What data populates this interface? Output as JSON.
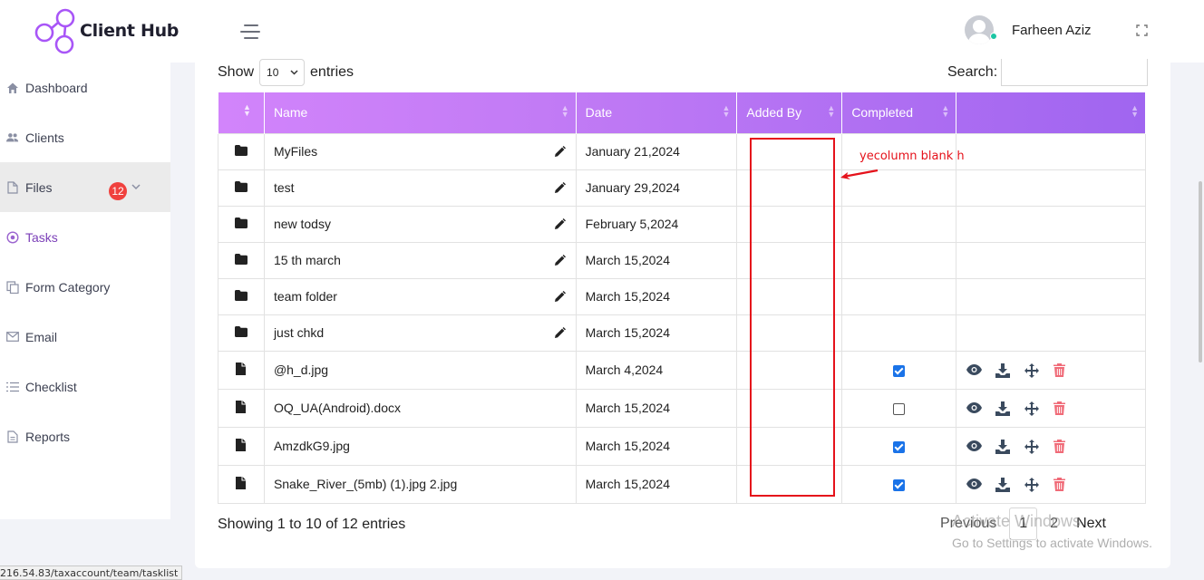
{
  "app": {
    "name": "Client Hub"
  },
  "header": {
    "user_name": "Farheen Aziz"
  },
  "sidebar": {
    "items": [
      {
        "label": "Dashboard",
        "icon": "home-icon"
      },
      {
        "label": "Clients",
        "icon": "users-icon"
      },
      {
        "label": "Files",
        "icon": "file-icon",
        "badge": "12",
        "active": true
      },
      {
        "label": "Tasks",
        "icon": "target-icon"
      },
      {
        "label": "Form Category",
        "icon": "copy-icon"
      },
      {
        "label": "Email",
        "icon": "envelope-icon"
      },
      {
        "label": "Checklist",
        "icon": "list-icon"
      },
      {
        "label": "Reports",
        "icon": "document-icon"
      }
    ]
  },
  "table_controls": {
    "show_label": "Show",
    "entries_label": "entries",
    "page_size": "10",
    "search_label": "Search:"
  },
  "table": {
    "columns": [
      "",
      "Name",
      "Date",
      "Added By",
      "Completed",
      ""
    ],
    "rows": [
      {
        "type": "folder",
        "name": "MyFiles",
        "date": "January 21,2024",
        "added_by": ""
      },
      {
        "type": "folder",
        "name": "test",
        "date": "January 29,2024",
        "added_by": ""
      },
      {
        "type": "folder",
        "name": "new todsy",
        "date": "February 5,2024",
        "added_by": ""
      },
      {
        "type": "folder",
        "name": "15 th march",
        "date": "March 15,2024",
        "added_by": ""
      },
      {
        "type": "folder",
        "name": "team folder",
        "date": "March 15,2024",
        "added_by": ""
      },
      {
        "type": "folder",
        "name": "just chkd",
        "date": "March 15,2024",
        "added_by": ""
      },
      {
        "type": "file",
        "name": "@h_d.jpg",
        "date": "March 4,2024",
        "added_by": "",
        "completed": true
      },
      {
        "type": "file",
        "name": "OQ_UA(Android).docx",
        "date": "March 15,2024",
        "added_by": "",
        "completed": false
      },
      {
        "type": "file",
        "name": "AmzdkG9.jpg",
        "date": "March 15,2024",
        "added_by": "",
        "completed": true
      },
      {
        "type": "file",
        "name": "Snake_River_(5mb) (1).jpg 2.jpg",
        "date": "March 15,2024",
        "added_by": "",
        "completed": true
      }
    ]
  },
  "footer": {
    "info": "Showing 1 to 10 of 12 entries",
    "pagination": {
      "previous": "Previous",
      "pages": [
        "1",
        "2"
      ],
      "next": "Next"
    }
  },
  "annotation": {
    "text": "yecolumn blank h",
    "color": "#e5121b"
  },
  "watermark": {
    "title": "Activate Windows",
    "subtitle": "Go to Settings to activate Windows."
  },
  "status_bar": {
    "url": "216.54.83/taxaccount/team/tasklist"
  },
  "colors": {
    "header_gradient_start": "#d284fb",
    "header_gradient_end": "#a065f0",
    "accent": "#7b3fb8",
    "badge": "#f0413e",
    "checkbox": "#1a73e8",
    "delete": "#f06b78"
  }
}
